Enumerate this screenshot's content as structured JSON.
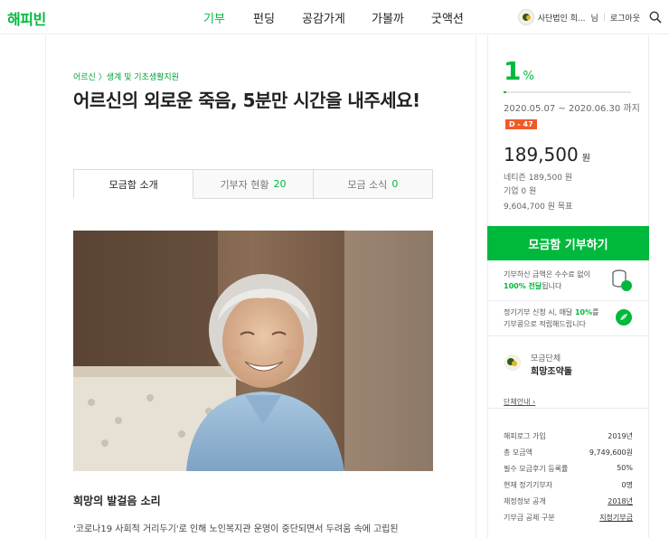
{
  "header": {
    "logo": "해피빈",
    "nav": [
      {
        "label": "기부",
        "active": true
      },
      {
        "label": "펀딩",
        "active": false
      },
      {
        "label": "공감가게",
        "active": false
      },
      {
        "label": "가볼까",
        "active": false
      },
      {
        "label": "굿액션",
        "active": false
      }
    ],
    "user_name": "사단법인 희...",
    "user_suffix": "님",
    "logout": "로그아웃",
    "search_icon": "search-icon"
  },
  "campaign": {
    "breadcrumb": "어르신 〉생계 및 기초생활지원",
    "title": "어르신의 외로운 죽음, 5분만 시간을 내주세요!",
    "tabs": [
      {
        "label": "모금함 소개",
        "count": ""
      },
      {
        "label": "기부자 현황",
        "count": "20"
      },
      {
        "label": "모금 소식",
        "count": "0"
      }
    ],
    "section_title": "희망의 발걸음 소리",
    "intro_text": "'코로나19 사회적 거리두기'로 인해 노인복지관 운영이 중단되면서 두려움 속에 고립된"
  },
  "sidebar": {
    "percent": "1",
    "percent_unit": "%",
    "progress_fraction": 0.0197,
    "period": "2020.05.07 ~ 2020.06.30 까지",
    "dday": "D - 47",
    "amount": "189,500",
    "amount_unit": "원",
    "netizen": "네티즌 189,500 원",
    "company": "기업 0 원",
    "goal": "9,604,700 원 목표",
    "donate_button": "모금함 기부하기",
    "info1_line1": "기부하신 금액은 수수료 없이",
    "info1_bold": "100% 전달",
    "info1_line2_rest": "됩니다",
    "info2_line1_pre": "정기기부 신청 시, 매달 ",
    "info2_bold": "10%",
    "info2_line1_post": "를",
    "info2_line2": "기부콩으로 적립해드립니다",
    "org_label": "모금단체",
    "org_name": "희망조약돌",
    "org_link": "단체안내 ›",
    "stats": [
      {
        "key": "해피로그 가입",
        "value": "2019년"
      },
      {
        "key": "총 모금액",
        "value": "9,749,600원"
      },
      {
        "key": "필수 모금후기 등록률",
        "value": "50%"
      },
      {
        "key": "현재 정기기부자",
        "value": "0명"
      },
      {
        "key": "재정정보 공개",
        "value": "2018년"
      },
      {
        "key": "기부금 공제 구분",
        "value": "지정기부금"
      }
    ]
  },
  "colors": {
    "brand_green": "#00b93c",
    "dday_orange": "#f05a28"
  }
}
